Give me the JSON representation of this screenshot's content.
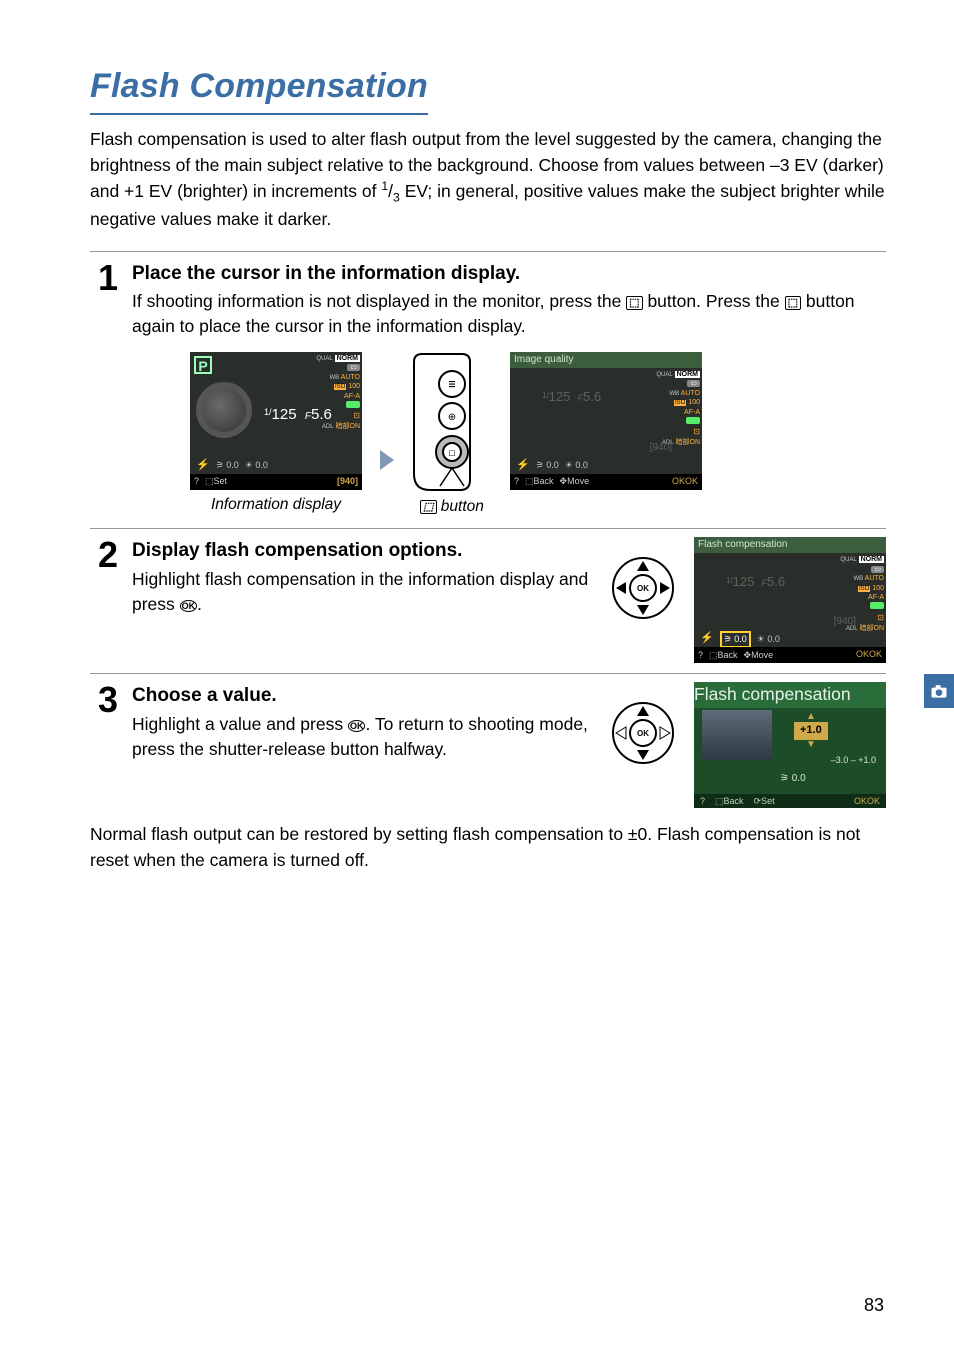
{
  "title": "Flash Compensation",
  "intro_parts": {
    "p1": "Flash compensation is used to alter flash output from the level suggested by the camera, changing the brightness of the main subject relative to the background. Choose from values between –3 EV (darker) and +1 EV (brighter) in increments of ",
    "frac_num": "1",
    "frac_den": "3",
    "p2": " EV; in general, positive values make the subject brighter while negative values make it darker."
  },
  "steps": [
    {
      "num": "1",
      "head": "Place the cursor in the information display.",
      "body_a": "If shooting information is not displayed in the monitor, press the ",
      "body_b": " button. Press the ",
      "body_c": " button again to place the cursor in the information display.",
      "caption_left": "Information display",
      "caption_mid_suffix": " button"
    },
    {
      "num": "2",
      "head": "Display flash compensation options.",
      "body_a": "Highlight flash compensation in the information display and press ",
      "body_b": "."
    },
    {
      "num": "3",
      "head": "Choose a value.",
      "body_a": "Highlight a value and press ",
      "body_b": ".  To return to shooting mode, press the shutter-release button halfway."
    }
  ],
  "closing": "Normal flash output can be restored by setting flash compensation to ±0.  Flash compensation is not reset when the camera is turned off.",
  "page_number": "83",
  "lcd": {
    "modeP": "P",
    "shutter_a": "1/",
    "shutter_b": "125",
    "aperture_a": "F",
    "aperture_b": "5.6",
    "norm": "NORM",
    "qual": "QUAL",
    "wb": "WB",
    "auto": "AUTO",
    "iso_lbl": "ISO",
    "iso_val": "100",
    "afa": "AF-A",
    "adl": "ADL",
    "hb_on": "暗部ON",
    "set_label": "Set",
    "count": "[940]",
    "flash00": "0.0",
    "exp00": "0.0",
    "image_quality": "Image quality",
    "back": "Back",
    "move": "Move",
    "okok": "OK",
    "flash_comp_title": "Flash compensation",
    "flash_val": "+1.0",
    "flash_range": "–3.0 – +1.0",
    "flash_cur": "0.0",
    "set2": "Set"
  }
}
